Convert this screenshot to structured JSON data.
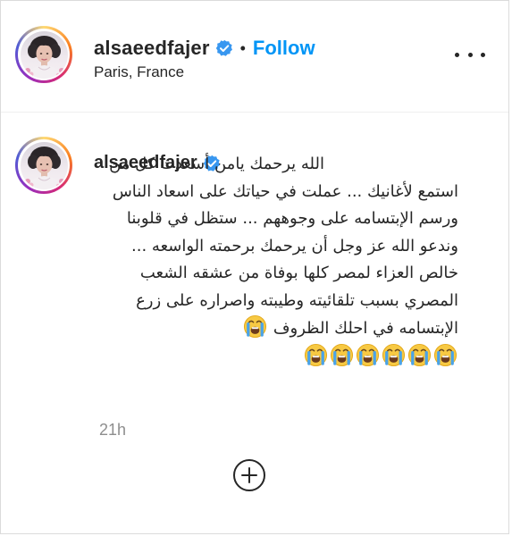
{
  "post": {
    "header": {
      "username": "alsaeedfajer",
      "separator": "•",
      "follow_label": "Follow",
      "location": "Paris, France",
      "more_icon": "more-options-icon"
    },
    "caption": {
      "username": "alsaeedfajer",
      "text": "الله يرحمك يامن أسعدت كل من استمع لأغانيك ... عملت في حياتك على اسعاد الناس ورسم الإبتسامه على وجوههم ... ستظل في قلوبنا وندعو الله عز وجل أن يرحمك برحمته الواسعه ... خالص العزاء لمصر كلها بوفاة من عشقه الشعب المصري بسبب تلقائيته وطيبته واصراره على زرع الإبتسامه في احلك الظروف",
      "emoji_name": "loudly-crying-face-icon",
      "emoji_count_inline": 1,
      "emoji_count_trailing": 6
    },
    "timestamp": "21h",
    "load_more_icon": "plus-circle-icon"
  },
  "colors": {
    "link_blue": "#0095f6",
    "text": "#262626",
    "muted": "#8e8e8e",
    "verified_blue": "#3897f0",
    "border": "#dbdbdb"
  }
}
